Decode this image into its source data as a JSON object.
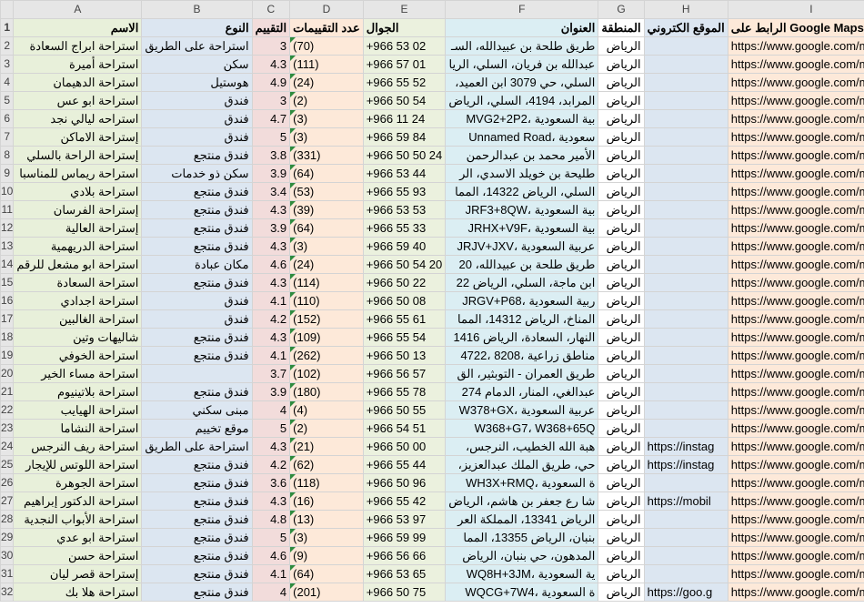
{
  "column_letters": [
    "A",
    "B",
    "C",
    "D",
    "E",
    "F",
    "G",
    "H",
    "I"
  ],
  "header_row": {
    "row_number": "1",
    "A": "الاسم",
    "B": "النوع",
    "C": "التقييم",
    "D": "عدد التقييمات",
    "E": "الجوال",
    "F": "العنوان",
    "G": "المنطقة",
    "H": "الموقع الكتروني",
    "I": "الرابط على Google Maps"
  },
  "rows": [
    {
      "n": "2",
      "A": "استراحة ابراج السعادة",
      "B": "استراحة على الطريق",
      "C": "3",
      "D": "(70)",
      "E": "+966 53 02",
      "F": "طريق طلحة بن عبيدالله، السـ",
      "G": "الرياض",
      "H": "",
      "I": "https://www.google.com/maps/"
    },
    {
      "n": "3",
      "A": "استراحة أميرة",
      "B": "سكن",
      "C": "4.3",
      "D": "(111)",
      "E": "+966 57 01",
      "F": "عبدالله بن فريان، السلي، الريا",
      "G": "الرياض",
      "H": "",
      "I": "https://www.google.com/maps/"
    },
    {
      "n": "4",
      "A": "استراحة الدهيمان",
      "B": "هوستيل",
      "C": "4.9",
      "D": "(24)",
      "E": "+966 55 52",
      "F": "السلي، حي 3079 ابن العميد،",
      "G": "الرياض",
      "H": "",
      "I": "https://www.google.com/maps/"
    },
    {
      "n": "5",
      "A": "استراحة ابو عس",
      "B": "فندق",
      "C": "3",
      "D": "(2)",
      "E": "+966 50 54",
      "F": "المرابد، 4194، السلي، الرياض",
      "G": "الرياض",
      "H": "",
      "I": "https://www.google.com/maps/"
    },
    {
      "n": "6",
      "A": "استراحه ليالي نجد",
      "B": "فندق",
      "C": "4.7",
      "D": "(3)",
      "E": "+966 11 24",
      "F": "بية السعودية ،MVG2+2P2",
      "G": "الرياض",
      "H": "",
      "I": "https://www.google.com/maps/"
    },
    {
      "n": "7",
      "A": "إستراحة الاماكن",
      "B": "فندق",
      "C": "5",
      "D": "(3)",
      "E": "+966 59 84",
      "F": "سعودية ،Unnamed Road",
      "G": "الرياض",
      "H": "",
      "I": "https://www.google.com/maps/"
    },
    {
      "n": "8",
      "A": "إستراحة الراحة بالسلي",
      "B": "فندق منتجع",
      "C": "3.8",
      "D": "(331)",
      "E": "+966 50 50 24",
      "F": "الأمير محمد بن عبدالرحمن",
      "G": "الرياض",
      "H": "",
      "I": "https://www.google.com/maps/"
    },
    {
      "n": "9",
      "A": "استراحة ريماس للمناسبا",
      "B": "سكن ذو خدمات",
      "C": "3.9",
      "D": "(64)",
      "E": "+966 53 44",
      "F": "طليحة بن خويلد الاسدي، الر",
      "G": "الرياض",
      "H": "",
      "I": "https://www.google.com/maps/"
    },
    {
      "n": "10",
      "A": "استراحة بلادي",
      "B": "فندق منتجع",
      "C": "3.4",
      "D": "(53)",
      "E": "+966 55 93",
      "F": "السلي، الرياض 14322، المما",
      "G": "الرياض",
      "H": "",
      "I": "https://www.google.com/maps/"
    },
    {
      "n": "11",
      "A": "إستراحة الفرسان",
      "B": "فندق منتجع",
      "C": "4.3",
      "D": "(39)",
      "E": "+966 53 53",
      "F": "بية السعودية ،JRF3+8QW",
      "G": "الرياض",
      "H": "",
      "I": "https://www.google.com/maps/"
    },
    {
      "n": "12",
      "A": "إستراحة العالية",
      "B": "فندق منتجع",
      "C": "3.9",
      "D": "(64)",
      "E": "+966 55 33",
      "F": "بية السعودية ،JRHX+V9F",
      "G": "الرياض",
      "H": "",
      "I": "https://www.google.com/maps/"
    },
    {
      "n": "13",
      "A": "استراحة الدريهمية",
      "B": "فندق منتجع",
      "C": "4.3",
      "D": "(3)",
      "E": "+966 59 40",
      "F": "عربية السعودية ،JRJV+JXV",
      "G": "الرياض",
      "H": "",
      "I": "https://www.google.com/maps/"
    },
    {
      "n": "14",
      "A": "استراحة ابو مشعل للرقم",
      "B": "مكان عبادة",
      "C": "4.6",
      "D": "(24)",
      "E": "+966 50 54 20",
      "F": "طريق طلحة بن عبيدالله، 20",
      "G": "الرياض",
      "H": "",
      "I": "https://www.google.com/maps/"
    },
    {
      "n": "15",
      "A": "استراحة السعادة",
      "B": "فندق منتجع",
      "C": "4.3",
      "D": "(114)",
      "E": "+966 50 22",
      "F": "ابن ماجة، السلي، الرياض 22",
      "G": "الرياض",
      "H": "",
      "I": "https://www.google.com/maps/"
    },
    {
      "n": "16",
      "A": "استراحة اجدادي",
      "B": "فندق",
      "C": "4.1",
      "D": "(110)",
      "E": "+966 50 08",
      "F": "ربية السعودية ،JRGV+P68",
      "G": "الرياض",
      "H": "",
      "I": "https://www.google.com/maps/"
    },
    {
      "n": "17",
      "A": "استراحة الغالبين",
      "B": "فندق",
      "C": "4.2",
      "D": "(152)",
      "E": "+966 55 61",
      "F": "المناخ، الرياض 14312، المما",
      "G": "الرياض",
      "H": "",
      "I": "https://www.google.com/maps/"
    },
    {
      "n": "18",
      "A": "شاليهات وتين",
      "B": "فندق منتجع",
      "C": "4.3",
      "D": "(109)",
      "E": "+966 55 54",
      "F": "النهار، السعادة، الرياض 1416",
      "G": "الرياض",
      "H": "",
      "I": "https://www.google.com/maps/"
    },
    {
      "n": "19",
      "A": "استراحة الخوفي",
      "B": "فندق منتجع",
      "C": "4.1",
      "D": "(262)",
      "E": "+966 50 13",
      "F": "مناطق زراعية ،8208 ،4722",
      "G": "الرياض",
      "H": "",
      "I": "https://www.google.com/maps/"
    },
    {
      "n": "20",
      "A": "استراحة مساء الخير",
      "B": "",
      "C": "3.7",
      "D": "(102)",
      "E": "+966 56 57",
      "F": "طريق العمران - التوبثير، الق",
      "G": "الرياض",
      "H": "",
      "I": "https://www.google.com/maps/"
    },
    {
      "n": "21",
      "A": "استراحة بلاتينيوم",
      "B": "فندق منتجع",
      "C": "3.9",
      "D": "(180)",
      "E": "+966 55 78",
      "F": "عبدالغي، المنار، الدمام 274",
      "G": "الرياض",
      "H": "",
      "I": "https://www.google.com/maps/"
    },
    {
      "n": "22",
      "A": "استراحة الهيايب",
      "B": "مبنى سكني",
      "C": "4",
      "D": "(4)",
      "E": "+966 50 55",
      "F": "عربية السعودية ،W378+GX",
      "G": "الرياض",
      "H": "",
      "I": "https://www.google.com/maps/"
    },
    {
      "n": "23",
      "A": "استراحة النشاما",
      "B": "موقع تخييم",
      "C": "5",
      "D": "(2)",
      "E": "+966 54 51",
      "F": "W368+G7، W368+65Q",
      "G": "الرياض",
      "H": "",
      "I": "https://www.google.com/maps/"
    },
    {
      "n": "24",
      "A": "استراحة ريف النرجس",
      "B": "استراحة على الطريق",
      "C": "4.3",
      "D": "(21)",
      "E": "+966 50 00",
      "F": "هبة الله الخطيب، النرجس،",
      "G": "الرياض",
      "H": "https://instag",
      "I": "https://www.google.com/maps/"
    },
    {
      "n": "25",
      "A": "استراحة اللوتس للإيجار",
      "B": "فندق منتجع",
      "C": "4.2",
      "D": "(62)",
      "E": "+966 55 44",
      "F": "حي، طريق الملك عبدالعزيز،",
      "G": "الرياض",
      "H": "https://instag",
      "I": "https://www.google.com/maps/"
    },
    {
      "n": "26",
      "A": "استراحة الجوهرة",
      "B": "فندق منتجع",
      "C": "3.6",
      "D": "(118)",
      "E": "+966 50 96",
      "F": "ة السعودية ،WH3X+RMQ",
      "G": "الرياض",
      "H": "",
      "I": "https://www.google.com/maps/"
    },
    {
      "n": "27",
      "A": "استراحة الدكتور إبراهيم",
      "B": "فندق منتجع",
      "C": "4.3",
      "D": "(16)",
      "E": "+966 55 42",
      "F": "شا رع جعفر بن هاشم، الرياض",
      "G": "الرياض",
      "H": "https://mobil",
      "I": "https://www.google.com/maps/"
    },
    {
      "n": "28",
      "A": "استراحة الأبواب النجدية",
      "B": "فندق منتجع",
      "C": "4.8",
      "D": "(13)",
      "E": "+966 53 97",
      "F": "الرياض 13341، المملكة العر",
      "G": "الرياض",
      "H": "",
      "I": "https://www.google.com/maps/"
    },
    {
      "n": "29",
      "A": "استراحة ابو عدي",
      "B": "فندق منتجع",
      "C": "5",
      "D": "(3)",
      "E": "+966 59 99",
      "F": "بنبان، الرياض 13355، المما",
      "G": "الرياض",
      "H": "",
      "I": "https://www.google.com/maps/"
    },
    {
      "n": "30",
      "A": "استراحة حسن",
      "B": "فندق منتجع",
      "C": "4.6",
      "D": "(9)",
      "E": "+966 56 66",
      "F": "المدهون، حي بنبان، الرياض",
      "G": "الرياض",
      "H": "",
      "I": "https://www.google.com/maps/"
    },
    {
      "n": "31",
      "A": "إستراحة قصر ليان",
      "B": "فندق منتجع",
      "C": "4.1",
      "D": "(64)",
      "E": "+966 53 65",
      "F": "ية السعودية ،WQ8H+3JM",
      "G": "الرياض",
      "H": "",
      "I": "https://www.google.com/maps/"
    },
    {
      "n": "32",
      "A": "استراحة هلا بك",
      "B": "فندق منتجع",
      "C": "4",
      "D": "(201)",
      "E": "+966 50 75",
      "F": "ة السعودية ،WQCG+7W4",
      "G": "الرياض",
      "H": "https://goo.g",
      "I": "https://www.google.com/maps/"
    }
  ]
}
